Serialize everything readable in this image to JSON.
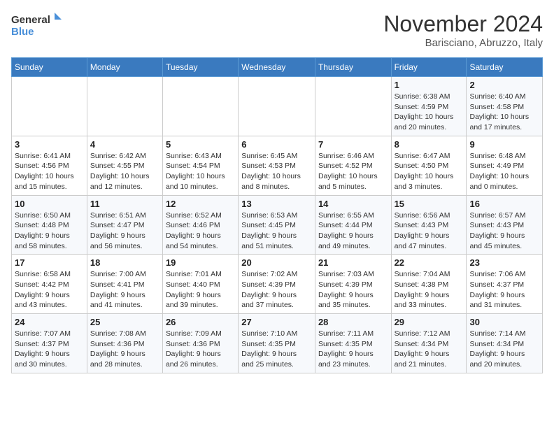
{
  "logo": {
    "line1": "General",
    "line2": "Blue"
  },
  "title": "November 2024",
  "subtitle": "Barisciano, Abruzzo, Italy",
  "weekdays": [
    "Sunday",
    "Monday",
    "Tuesday",
    "Wednesday",
    "Thursday",
    "Friday",
    "Saturday"
  ],
  "weeks": [
    [
      {
        "day": "",
        "info": ""
      },
      {
        "day": "",
        "info": ""
      },
      {
        "day": "",
        "info": ""
      },
      {
        "day": "",
        "info": ""
      },
      {
        "day": "",
        "info": ""
      },
      {
        "day": "1",
        "info": "Sunrise: 6:38 AM\nSunset: 4:59 PM\nDaylight: 10 hours\nand 20 minutes."
      },
      {
        "day": "2",
        "info": "Sunrise: 6:40 AM\nSunset: 4:58 PM\nDaylight: 10 hours\nand 17 minutes."
      }
    ],
    [
      {
        "day": "3",
        "info": "Sunrise: 6:41 AM\nSunset: 4:56 PM\nDaylight: 10 hours\nand 15 minutes."
      },
      {
        "day": "4",
        "info": "Sunrise: 6:42 AM\nSunset: 4:55 PM\nDaylight: 10 hours\nand 12 minutes."
      },
      {
        "day": "5",
        "info": "Sunrise: 6:43 AM\nSunset: 4:54 PM\nDaylight: 10 hours\nand 10 minutes."
      },
      {
        "day": "6",
        "info": "Sunrise: 6:45 AM\nSunset: 4:53 PM\nDaylight: 10 hours\nand 8 minutes."
      },
      {
        "day": "7",
        "info": "Sunrise: 6:46 AM\nSunset: 4:52 PM\nDaylight: 10 hours\nand 5 minutes."
      },
      {
        "day": "8",
        "info": "Sunrise: 6:47 AM\nSunset: 4:50 PM\nDaylight: 10 hours\nand 3 minutes."
      },
      {
        "day": "9",
        "info": "Sunrise: 6:48 AM\nSunset: 4:49 PM\nDaylight: 10 hours\nand 0 minutes."
      }
    ],
    [
      {
        "day": "10",
        "info": "Sunrise: 6:50 AM\nSunset: 4:48 PM\nDaylight: 9 hours\nand 58 minutes."
      },
      {
        "day": "11",
        "info": "Sunrise: 6:51 AM\nSunset: 4:47 PM\nDaylight: 9 hours\nand 56 minutes."
      },
      {
        "day": "12",
        "info": "Sunrise: 6:52 AM\nSunset: 4:46 PM\nDaylight: 9 hours\nand 54 minutes."
      },
      {
        "day": "13",
        "info": "Sunrise: 6:53 AM\nSunset: 4:45 PM\nDaylight: 9 hours\nand 51 minutes."
      },
      {
        "day": "14",
        "info": "Sunrise: 6:55 AM\nSunset: 4:44 PM\nDaylight: 9 hours\nand 49 minutes."
      },
      {
        "day": "15",
        "info": "Sunrise: 6:56 AM\nSunset: 4:43 PM\nDaylight: 9 hours\nand 47 minutes."
      },
      {
        "day": "16",
        "info": "Sunrise: 6:57 AM\nSunset: 4:43 PM\nDaylight: 9 hours\nand 45 minutes."
      }
    ],
    [
      {
        "day": "17",
        "info": "Sunrise: 6:58 AM\nSunset: 4:42 PM\nDaylight: 9 hours\nand 43 minutes."
      },
      {
        "day": "18",
        "info": "Sunrise: 7:00 AM\nSunset: 4:41 PM\nDaylight: 9 hours\nand 41 minutes."
      },
      {
        "day": "19",
        "info": "Sunrise: 7:01 AM\nSunset: 4:40 PM\nDaylight: 9 hours\nand 39 minutes."
      },
      {
        "day": "20",
        "info": "Sunrise: 7:02 AM\nSunset: 4:39 PM\nDaylight: 9 hours\nand 37 minutes."
      },
      {
        "day": "21",
        "info": "Sunrise: 7:03 AM\nSunset: 4:39 PM\nDaylight: 9 hours\nand 35 minutes."
      },
      {
        "day": "22",
        "info": "Sunrise: 7:04 AM\nSunset: 4:38 PM\nDaylight: 9 hours\nand 33 minutes."
      },
      {
        "day": "23",
        "info": "Sunrise: 7:06 AM\nSunset: 4:37 PM\nDaylight: 9 hours\nand 31 minutes."
      }
    ],
    [
      {
        "day": "24",
        "info": "Sunrise: 7:07 AM\nSunset: 4:37 PM\nDaylight: 9 hours\nand 30 minutes."
      },
      {
        "day": "25",
        "info": "Sunrise: 7:08 AM\nSunset: 4:36 PM\nDaylight: 9 hours\nand 28 minutes."
      },
      {
        "day": "26",
        "info": "Sunrise: 7:09 AM\nSunset: 4:36 PM\nDaylight: 9 hours\nand 26 minutes."
      },
      {
        "day": "27",
        "info": "Sunrise: 7:10 AM\nSunset: 4:35 PM\nDaylight: 9 hours\nand 25 minutes."
      },
      {
        "day": "28",
        "info": "Sunrise: 7:11 AM\nSunset: 4:35 PM\nDaylight: 9 hours\nand 23 minutes."
      },
      {
        "day": "29",
        "info": "Sunrise: 7:12 AM\nSunset: 4:34 PM\nDaylight: 9 hours\nand 21 minutes."
      },
      {
        "day": "30",
        "info": "Sunrise: 7:14 AM\nSunset: 4:34 PM\nDaylight: 9 hours\nand 20 minutes."
      }
    ]
  ]
}
